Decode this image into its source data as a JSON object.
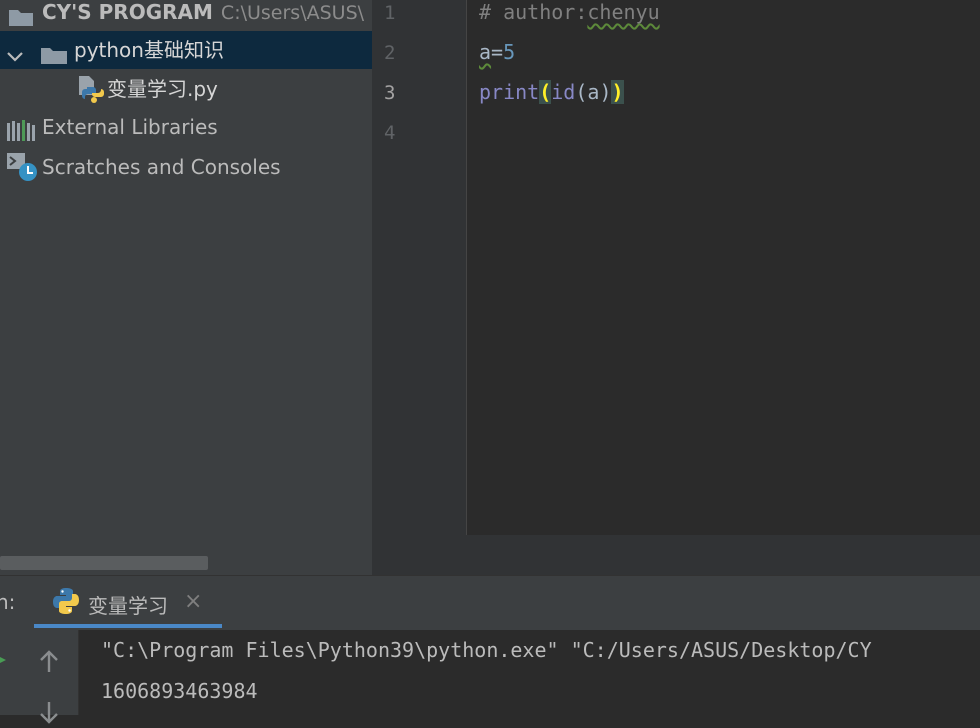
{
  "project": {
    "root_name": "CY'S PROGRAM",
    "root_path": "C:\\Users\\ASUS\\",
    "folder": "python基础知识",
    "file": "变量学习.py",
    "external_libraries": "External Libraries",
    "scratches": "Scratches and Consoles"
  },
  "editor": {
    "line_numbers": [
      "1",
      "2",
      "3",
      "4"
    ],
    "line1_comment": "# author:",
    "line1_author": "chenyu",
    "line2_var": "a",
    "line2_eq": "=",
    "line2_num": "5",
    "line3_print": "print",
    "line3_open": "(",
    "line3_id": "id",
    "line3_inner": "(a)",
    "line3_close": ")"
  },
  "run": {
    "label": "n:",
    "tab_title": "变量学习",
    "close_glyph": "×",
    "output_line1": "\"C:\\Program Files\\Python39\\python.exe\" \"C:/Users/ASUS/Desktop/CY",
    "output_line2": "1606893463984"
  },
  "colors": {
    "selection": "#0d293e",
    "tab_underline": "#4a88c7",
    "brace_highlight": "#ffef28"
  },
  "icons": [
    "folder-icon",
    "chevron-down-icon",
    "python-file-icon",
    "library-icon",
    "scratches-icon",
    "python-icon",
    "close-icon",
    "arrow-up-icon",
    "arrow-down-icon"
  ]
}
